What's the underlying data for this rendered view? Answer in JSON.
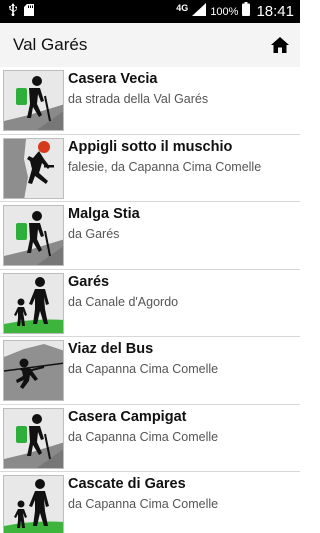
{
  "status_bar": {
    "network": "4G",
    "battery": "100%",
    "time": "18:41"
  },
  "app_bar": {
    "title": "Val Garés",
    "home_icon": "home-icon"
  },
  "items": [
    {
      "title": "Casera Vecia",
      "subtitle": "da strada della Val Garés",
      "icon": "hiker-icon"
    },
    {
      "title": "Appigli sotto il muschio",
      "subtitle": "falesie, da Capanna Cima Comelle",
      "icon": "climber-icon"
    },
    {
      "title": "Malga Stia",
      "subtitle": "da Garés",
      "icon": "hiker-icon"
    },
    {
      "title": "Garés",
      "subtitle": "da Canale d'Agordo",
      "icon": "family-walk-icon"
    },
    {
      "title": "Viaz del Bus",
      "subtitle": "da Capanna Cima Comelle",
      "icon": "via-ferrata-icon"
    },
    {
      "title": "Casera Campigat",
      "subtitle": "da Capanna Cima Comelle",
      "icon": "hiker-icon"
    },
    {
      "title": "Cascate di Gares",
      "subtitle": "da Capanna Cima Comelle",
      "icon": "family-walk-icon"
    }
  ]
}
